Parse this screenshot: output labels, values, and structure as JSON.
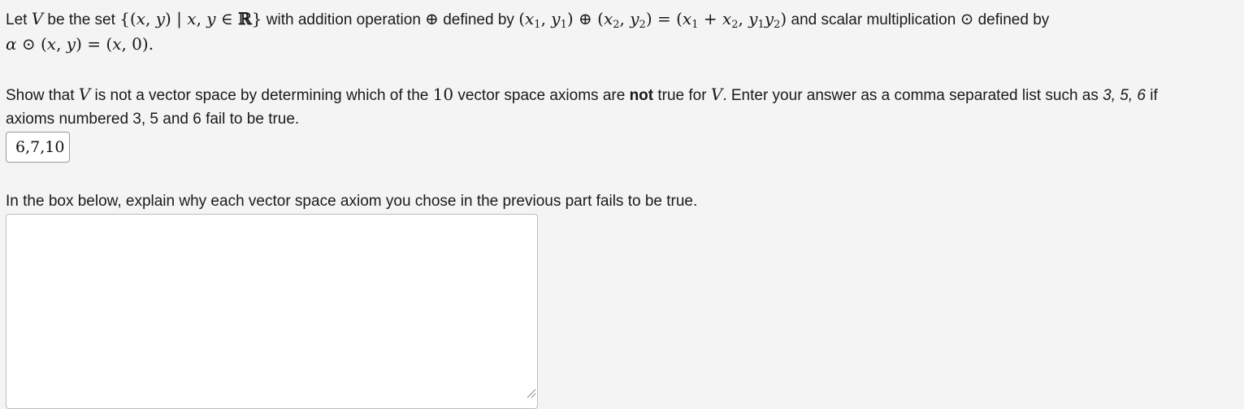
{
  "problem": {
    "intro_let": "Let ",
    "var_V": "V",
    "intro_set": " be the set ",
    "set_expr": "{(x, y) | x, y ∈ ℝ}",
    "with_addition": " with addition operation ",
    "oplus": "⊕",
    "defined_by": " defined by ",
    "add_def": "(x₁, y₁) ⊕ (x₂, y₂) = (x₁ + x₂, y₁y₂)",
    "and_scalar": " and scalar multiplication ",
    "odot": "⊙",
    "defined_by_2": " defined by",
    "scalar_def": "α ⊙ (x, y) = (x, 0)."
  },
  "question": {
    "show_that": "Show that ",
    "var_V": "V",
    "is_not": " is not a vector space by determining which of the ",
    "ten": "10",
    "axioms_are": " vector space axioms are ",
    "not_bold": "not",
    "true_for": " true for ",
    "enter_answer": ". Enter your answer as a comma separated list such as ",
    "example_list": "3, 5, 6",
    "if_text": " if",
    "line2": "axioms numbered 3, 5 and 6 fail to be true."
  },
  "answer_input": {
    "value": "6,7,10"
  },
  "explain": {
    "prompt": "In the box below, explain why each vector space axiom you chose in the previous part fails to be true.",
    "value": ""
  }
}
